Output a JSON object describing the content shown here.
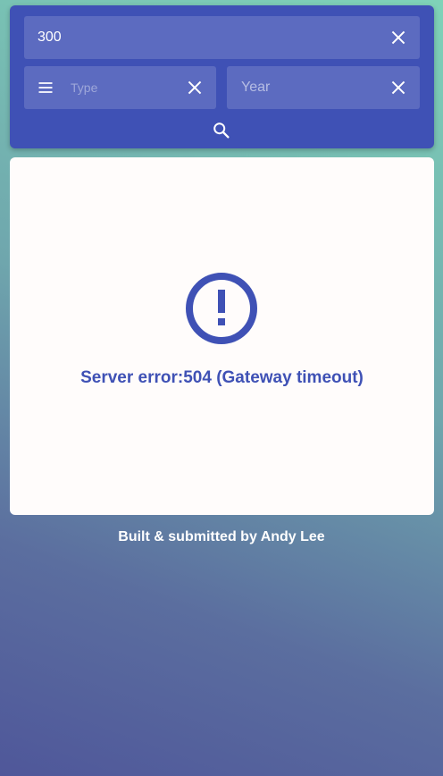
{
  "search": {
    "query_value": "300",
    "type_placeholder": "Type",
    "year_placeholder": "Year"
  },
  "result": {
    "error_message": "Server error:504 (Gateway timeout)"
  },
  "footer": {
    "text": "Built & submitted by Andy Lee"
  },
  "icons": {
    "clear": "close-icon",
    "menu": "menu-icon",
    "search": "search-icon",
    "error": "error-outline-icon"
  },
  "colors": {
    "primary": "#3f51b5",
    "field_background": "#5c6bc0",
    "card_background": "#fffcfb"
  }
}
